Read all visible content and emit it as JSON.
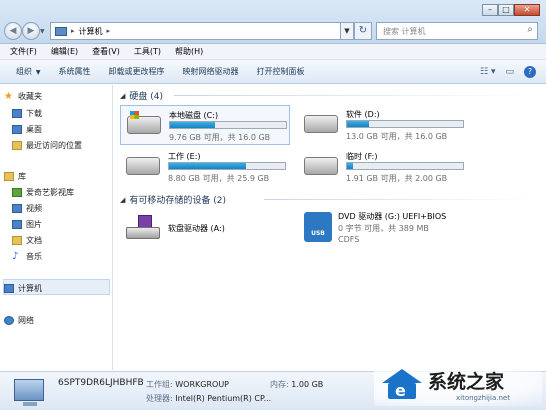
{
  "window": {
    "address": "计算机",
    "search_placeholder": "搜索 计算机"
  },
  "menu": [
    "文件(F)",
    "编辑(E)",
    "查看(V)",
    "工具(T)",
    "帮助(H)"
  ],
  "toolbar": {
    "organize": "组织",
    "system_props": "系统属性",
    "uninstall": "卸载或更改程序",
    "map_drive": "映射网络驱动器",
    "control_panel": "打开控制面板"
  },
  "sidebar": {
    "favorites": "收藏夹",
    "downloads": "下载",
    "desktop": "桌面",
    "recent": "最近访问的位置",
    "libraries": "库",
    "aiqiyi": "爱奇艺影视库",
    "videos": "视频",
    "pictures": "图片",
    "documents": "文档",
    "music": "音乐",
    "computer": "计算机",
    "network": "网络"
  },
  "hard_disks": {
    "title": "硬盘 (4)",
    "drives": [
      {
        "name": "本地磁盘 (C:)",
        "info": "9.76 GB 可用，共 16.0 GB",
        "used_fraction": 0.39
      },
      {
        "name": "软件 (D:)",
        "info": "13.0 GB 可用，共 16.0 GB",
        "used_fraction": 0.19
      },
      {
        "name": "工作 (E:)",
        "info": "8.80 GB 可用，共 25.9 GB",
        "used_fraction": 0.66
      },
      {
        "name": "临时 (F:)",
        "info": "1.91 GB 可用，共 2.00 GB",
        "used_fraction": 0.05
      }
    ]
  },
  "removable": {
    "title": "有可移动存储的设备 (2)",
    "floppy": "软盘驱动器 (A:)",
    "dvd_name": "DVD 驱动器 (G:) UEFI+BIOS",
    "dvd_info": "0 字节 可用，共 389 MB",
    "dvd_fs": "CDFS",
    "dvd_label": "USB"
  },
  "details": {
    "computer_name": "6SPT9DR6LJHBHFB",
    "workgroup_label": "工作组:",
    "workgroup": "WORKGROUP",
    "memory_label": "内存:",
    "memory": "1.00 GB",
    "cpu_label": "处理器:",
    "cpu": "Intel(R) Pentium(R) CP..."
  },
  "watermark": {
    "brand": "系统之家",
    "url": "xitongzhijia.net"
  }
}
